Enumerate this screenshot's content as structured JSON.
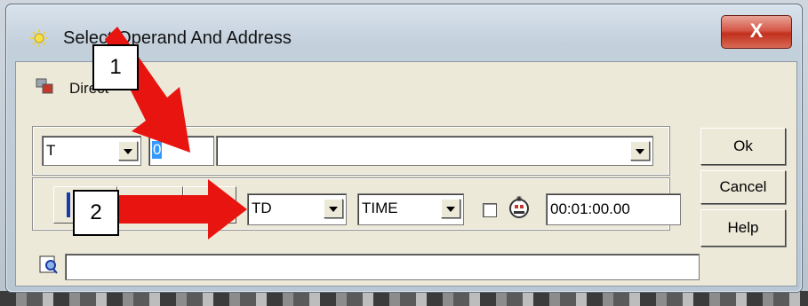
{
  "window": {
    "title": "Select Operand And Address",
    "close_label": "X"
  },
  "mode": {
    "label": "Direct"
  },
  "operand_row": {
    "operand_type": "T",
    "address_selected": "0",
    "symbol_value": ""
  },
  "type_row": {
    "data_type": "TD",
    "format": "TIME",
    "checkbox_checked": false,
    "time_value": "00:01:00.00"
  },
  "comment": {
    "value": ""
  },
  "buttons": {
    "ok": "Ok",
    "cancel": "Cancel",
    "help": "Help"
  },
  "callouts": {
    "one": "1",
    "two": "2"
  },
  "colors": {
    "callout_arrow": "#e8140f",
    "selection": "#3399ff",
    "close_button": "#c2301c"
  }
}
